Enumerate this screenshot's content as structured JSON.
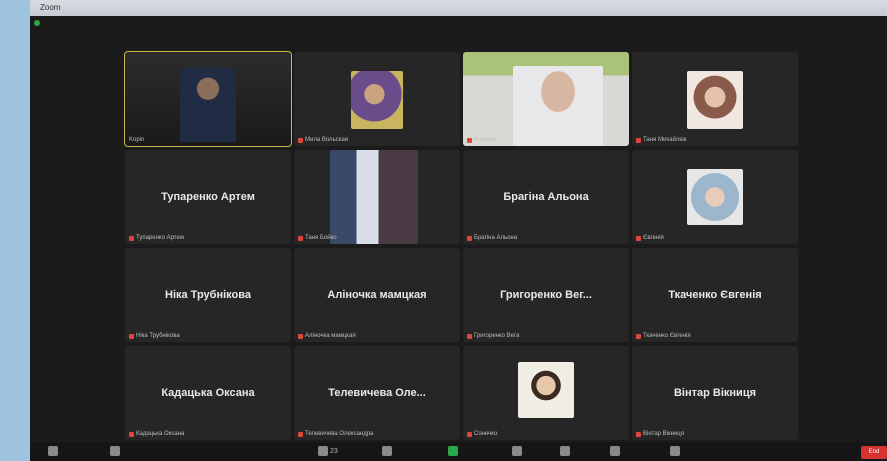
{
  "window": {
    "title": "Zoom",
    "right_text": ""
  },
  "gallery": {
    "tiles": [
      {
        "id": "t1",
        "name": "",
        "label": "Kopin",
        "video": true,
        "active": true
      },
      {
        "id": "t2",
        "name": "",
        "label": "Мила Вольская",
        "video": true
      },
      {
        "id": "t3",
        "name": "",
        "label": "Вчитель",
        "video": true
      },
      {
        "id": "t4",
        "name": "",
        "label": "Таня Михайлюк",
        "video": true
      },
      {
        "id": "t5",
        "name": "Тупаренко Артем",
        "label": "Тупаренко Артем",
        "video": false
      },
      {
        "id": "t6",
        "name": "",
        "label": "Таня Бойко",
        "video": true
      },
      {
        "id": "t7",
        "name": "Брагіна Альона",
        "label": "Брагіна Альона",
        "video": false
      },
      {
        "id": "t8",
        "name": "",
        "label": "Євгенія",
        "video": true
      },
      {
        "id": "t9",
        "name": "Ніка Трубнікова",
        "label": "Ніка Трубнікова",
        "video": false
      },
      {
        "id": "t10",
        "name": "Аліночка мамцкая",
        "label": "Аліночка мамцкая",
        "video": false
      },
      {
        "id": "t11",
        "name": "Григоренко Вег...",
        "label": "Григоренко Вега",
        "video": false
      },
      {
        "id": "t12",
        "name": "Ткаченко Євгенія",
        "label": "Ткаченко Євгенія",
        "video": false
      },
      {
        "id": "t13",
        "name": "Кадацька Оксана",
        "label": "Кадацька Оксана",
        "video": false
      },
      {
        "id": "t14",
        "name": "Телевичева Оле...",
        "label": "Телевичева Олександра",
        "video": false
      },
      {
        "id": "t15",
        "name": "",
        "label": "Сонечко",
        "video": true
      },
      {
        "id": "t16",
        "name": "Вінтар Вікниця",
        "label": "Вінтар Вікниця",
        "video": false
      }
    ]
  },
  "toolbar": {
    "mute_label": "",
    "video_label": "",
    "participants_count": "23",
    "chat_label": "",
    "end_label": "End"
  }
}
